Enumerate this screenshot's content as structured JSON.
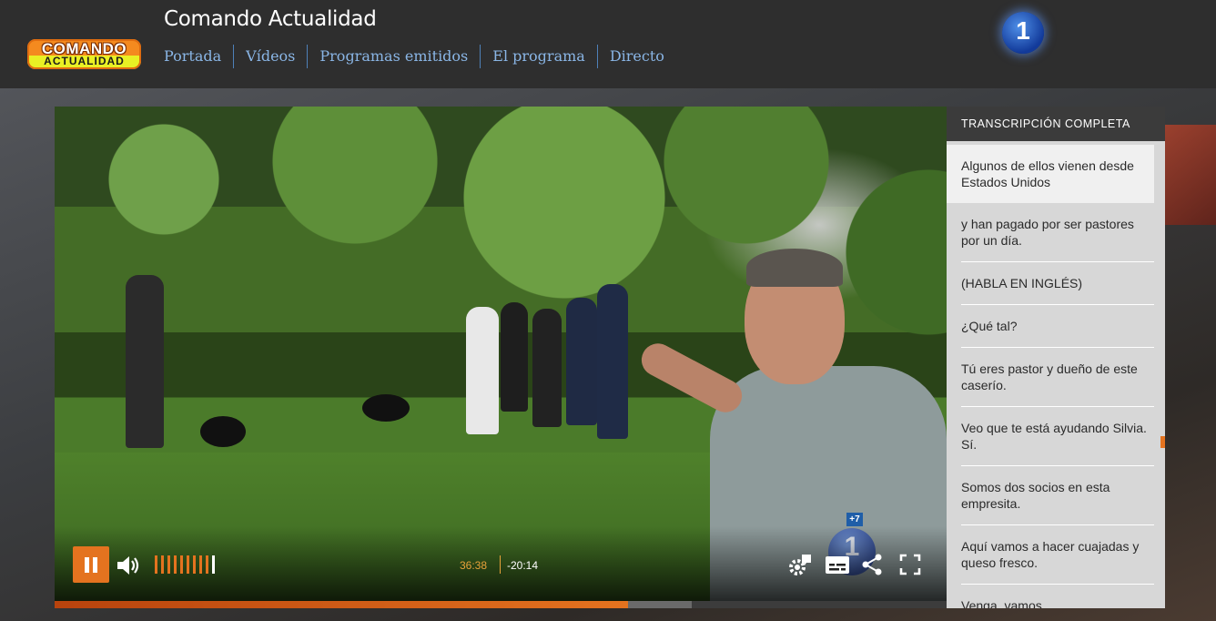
{
  "header": {
    "logo_line1": "COMANDO",
    "logo_line2": "ACTUALIDAD",
    "title": "Comando Actualidad",
    "nav": [
      "Portada",
      "Vídeos",
      "Programas emitidos",
      "El programa",
      "Directo"
    ],
    "channel_logo": "1"
  },
  "player": {
    "state": "playing",
    "current_time": "36:38",
    "remaining_time": "-20:14",
    "progress_fraction": 0.643,
    "buffer_fraction": 0.714,
    "volume_level": 0.9,
    "age_rating": "+7",
    "watermark": "1",
    "icons": [
      "pause-icon",
      "volume-icon",
      "settings-icon",
      "subtitles-icon",
      "share-icon",
      "fullscreen-icon"
    ],
    "accent_color": "#e4731f"
  },
  "transcript": {
    "heading": "TRANSCRIPCIÓN COMPLETA",
    "lines": [
      "Algunos de ellos vienen desde Estados Unidos",
      "y han pagado por ser pastores por un día.",
      "(HABLA EN INGLÉS)",
      "¿Qué tal?",
      "Tú eres pastor y dueño de este caserío.",
      "Veo que te está ayudando Silvia. Sí.",
      "Somos dos socios en esta empresita.",
      "Aquí vamos a hacer cuajadas y queso fresco.",
      "Venga, vamos"
    ],
    "active_index": 0
  }
}
